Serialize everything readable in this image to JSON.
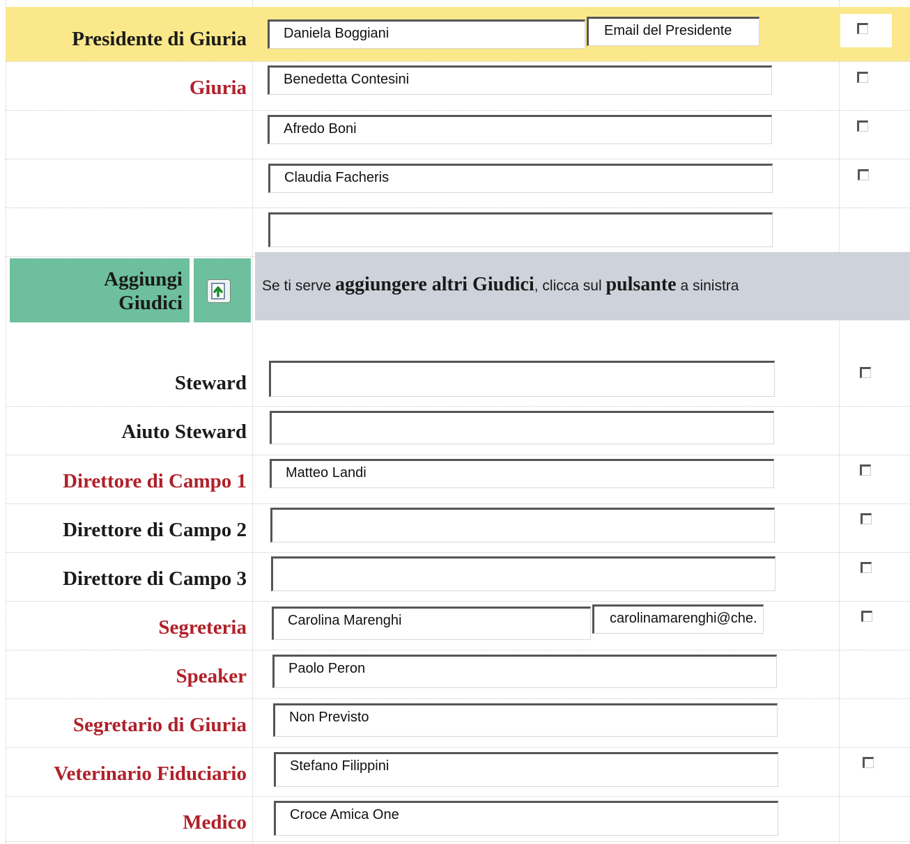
{
  "jury": {
    "president_label": "Presidente di Giuria",
    "president_name": "Daniela Boggiani",
    "president_email": "Email del Presidente",
    "giuria_label": "Giuria",
    "members": [
      "Benedetta Contesini",
      "Afredo Boni",
      "Claudia Facheris",
      ""
    ]
  },
  "add_judges": {
    "label_line1": "Aggiungi",
    "label_line2": "Giudici",
    "hint_part1": "Se ti serve ",
    "hint_bold1": "aggiungere altri Giudici",
    "hint_part2": ", clicca sul ",
    "hint_bold2": "pulsante",
    "hint_part3": " a sinistra"
  },
  "staff": {
    "steward_label": "Steward",
    "steward_value": "",
    "aiuto_steward_label": "Aiuto Steward",
    "aiuto_steward_value": "",
    "direttore1_label": "Direttore di Campo 1",
    "direttore1_value": "Matteo Landi",
    "direttore2_label": "Direttore di Campo 2",
    "direttore2_value": "",
    "direttore3_label": "Direttore di Campo 3",
    "direttore3_value": "",
    "segreteria_label": "Segreteria",
    "segreteria_value": "Carolina Marenghi",
    "segreteria_email": "carolinamarenghi@che.",
    "speaker_label": "Speaker",
    "speaker_value": "Paolo Peron",
    "segretario_label": "Segretario di Giuria",
    "segretario_value": "Non Previsto",
    "veterinario_label": "Veterinario Fiduciario",
    "veterinario_value": "Stefano Filippini",
    "medico_label": "Medico",
    "medico_value": "Croce Amica One"
  },
  "colors": {
    "president_row_bg": "#fae88a",
    "add_judges_bg": "#6dbf9e",
    "hint_bg": "#ced2da",
    "label_red": "#b0202a",
    "label_black": "#1a1a1a"
  },
  "icons": {
    "add_judges_button": "add-upload-icon"
  }
}
